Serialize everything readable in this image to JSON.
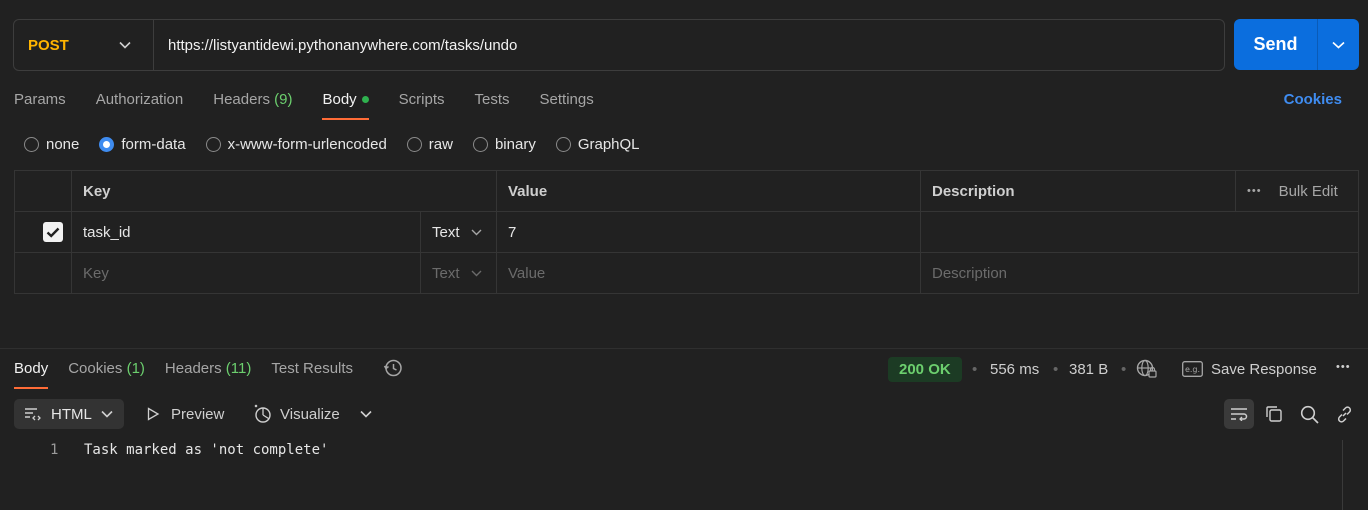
{
  "request": {
    "method": "POST",
    "url": "https://listyantidewi.pythonanywhere.com/tasks/undo",
    "send_label": "Send"
  },
  "tabs": [
    {
      "label": "Params"
    },
    {
      "label": "Authorization"
    },
    {
      "label": "Headers",
      "count": "(9)"
    },
    {
      "label": "Body"
    },
    {
      "label": "Scripts"
    },
    {
      "label": "Tests"
    },
    {
      "label": "Settings"
    }
  ],
  "cookies_label": "Cookies",
  "body_types": [
    "none",
    "form-data",
    "x-www-form-urlencoded",
    "raw",
    "binary",
    "GraphQL"
  ],
  "body_type_selected": "form-data",
  "table": {
    "headers": {
      "key": "Key",
      "value": "Value",
      "description": "Description",
      "bulk_edit": "Bulk Edit"
    },
    "rows": [
      {
        "checked": true,
        "key": "task_id",
        "type": "Text",
        "value": "7",
        "description": ""
      }
    ],
    "placeholder": {
      "key": "Key",
      "type": "Text",
      "value": "Value",
      "description": "Description"
    }
  },
  "response": {
    "tabs": [
      {
        "label": "Body"
      },
      {
        "label": "Cookies",
        "count": "(1)"
      },
      {
        "label": "Headers",
        "count": "(11)"
      },
      {
        "label": "Test Results"
      }
    ],
    "status": "200 OK",
    "time": "556 ms",
    "size": "381 B",
    "save_label": "Save Response",
    "format": "HTML",
    "preview_label": "Preview",
    "visualize_label": "Visualize",
    "lines": [
      {
        "num": "1",
        "text": "Task marked as 'not complete'"
      }
    ]
  },
  "colors": {
    "accent": "#ff6c37",
    "send": "#0b6ede",
    "method": "#ffb400",
    "ok": "#6ccf6e"
  }
}
